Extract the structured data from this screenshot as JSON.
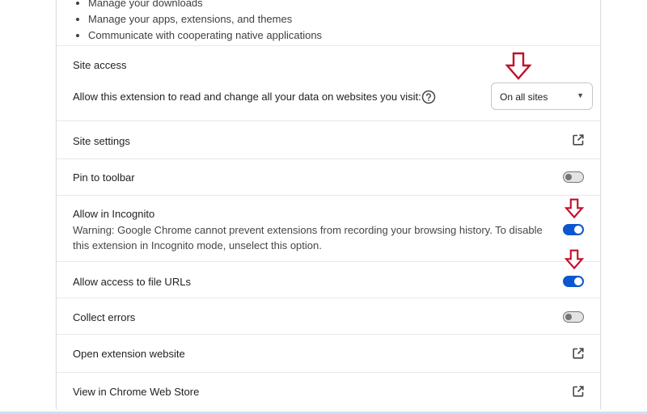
{
  "permissions": [
    "Manage your downloads",
    "Manage your apps, extensions, and themes",
    "Communicate with cooperating native applications"
  ],
  "site_access": {
    "heading": "Site access",
    "description": "Allow this extension to read and change all your data on websites you visit:",
    "help_icon": "question-circle-icon",
    "dropdown_value": "On all sites"
  },
  "rows": {
    "site_settings": {
      "label": "Site settings",
      "icon": "open-in-new-icon"
    },
    "pin_toolbar": {
      "label": "Pin to toolbar",
      "state": "off"
    },
    "incognito": {
      "label": "Allow in Incognito",
      "warning": "Warning: Google Chrome cannot prevent extensions from recording your browsing history. To disable this extension in Incognito mode, unselect this option.",
      "state": "on"
    },
    "file_urls": {
      "label": "Allow access to file URLs",
      "state": "on"
    },
    "collect_errors": {
      "label": "Collect errors",
      "state": "off"
    },
    "open_website": {
      "label": "Open extension website",
      "icon": "open-in-new-icon"
    },
    "web_store": {
      "label": "View in Chrome Web Store",
      "icon": "open-in-new-icon"
    }
  },
  "colors": {
    "toggle_on": "#0b57d0",
    "annotation_arrow": "#c0112a"
  }
}
